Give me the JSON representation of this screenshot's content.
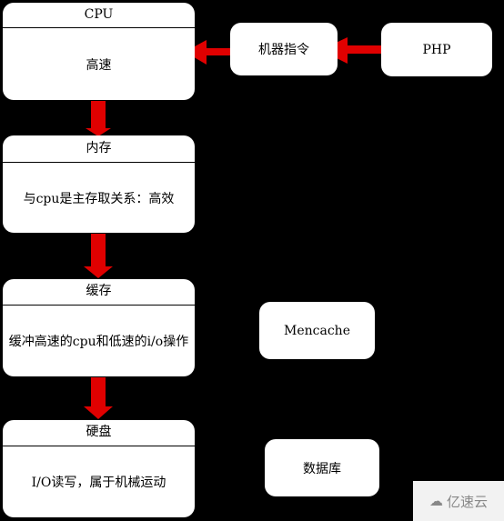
{
  "stack": [
    {
      "title": "CPU",
      "desc": "高速"
    },
    {
      "title": "内存",
      "desc": "与cpu是主存取关系：高效"
    },
    {
      "title": "缓存",
      "desc": "缓冲高速的cpu和低速的i/o操作"
    },
    {
      "title": "硬盘",
      "desc": "I/O读写，属于机械运动"
    }
  ],
  "side": {
    "machine_code": "机器指令",
    "php": "PHP",
    "memcache": "Mencache",
    "database": "数据库"
  },
  "arrow_color": "#e00000",
  "watermark": "亿速云"
}
